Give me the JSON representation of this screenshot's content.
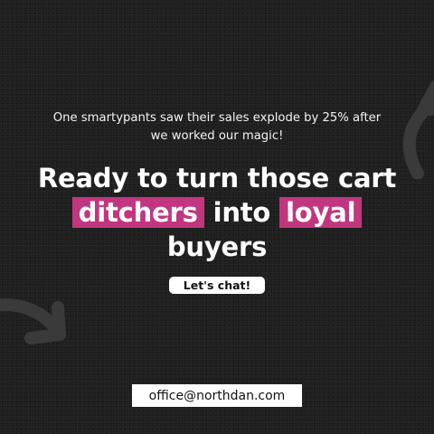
{
  "intro": {
    "line1": "One smartypants saw their sales explode by 25% after",
    "line2": "we worked our magic!"
  },
  "headline": {
    "line1": "Ready to turn those cart",
    "highlight1": "ditchers",
    "connector": "into",
    "highlight2": "loyal",
    "line3": "buyers"
  },
  "cta": {
    "label": "Let's chat!"
  },
  "contact": {
    "email": "office@northdan.com"
  },
  "colors": {
    "background": "#1f1f1f",
    "highlight": "#c2367f",
    "text": "#ffffff"
  },
  "decorations": [
    "curved-arrow-icon",
    "curved-arrow-icon"
  ]
}
